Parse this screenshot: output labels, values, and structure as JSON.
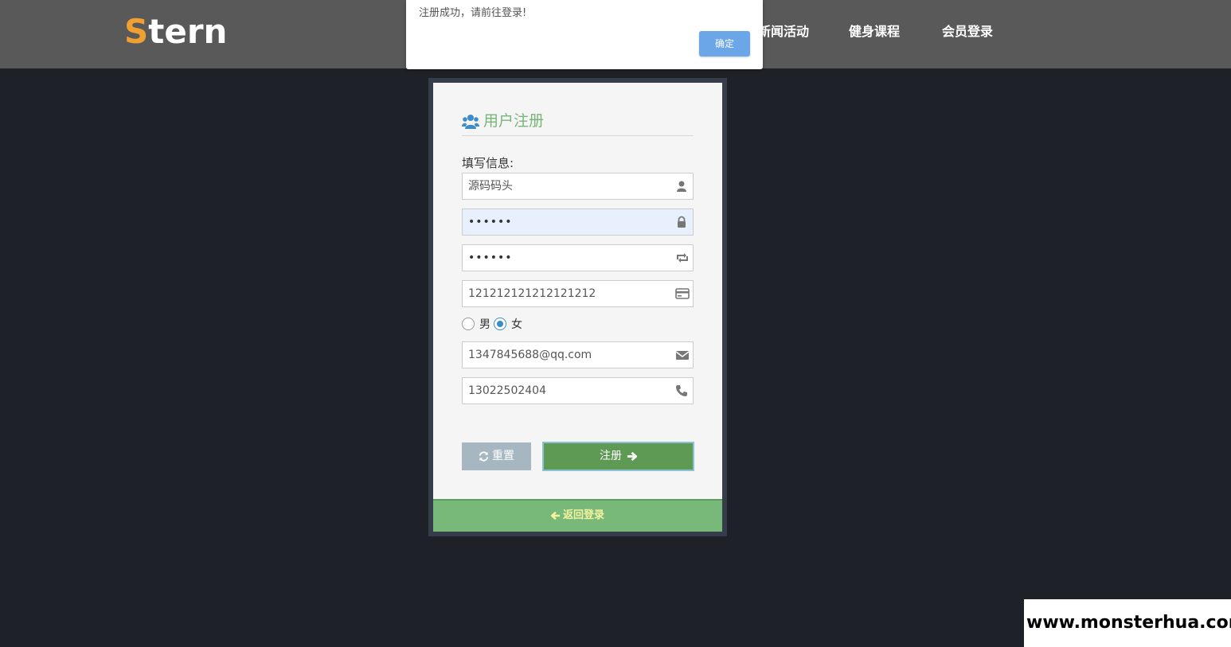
{
  "header": {
    "logo_first_letter": "S",
    "logo_rest": "tern",
    "nav": [
      "新闻活动",
      "健身课程",
      "会员登录"
    ]
  },
  "alert": {
    "message": "注册成功，请前往登录!",
    "ok_label": "确定"
  },
  "form": {
    "title": "用户注册",
    "section_label": "填写信息:",
    "username": "源码码头",
    "password_mask": "••••••",
    "confirm_mask": "••••••",
    "id_number": "121212121212121212",
    "gender_options": [
      "男",
      "女"
    ],
    "gender_selected": "女",
    "email": "1347845688@qq.com",
    "phone": "13022502404",
    "reset_label": "重置",
    "submit_label": "注册",
    "back_label": "返回登录"
  },
  "watermark": "www.monsterhua.com",
  "colors": {
    "header_bg": "#595959",
    "page_bg": "#1f2128",
    "logo_accent": "#f0a030",
    "title_green": "#78b578",
    "submit_green": "#5f9a55",
    "back_bar_green": "#78b878",
    "ok_blue": "#6aa6e8"
  }
}
